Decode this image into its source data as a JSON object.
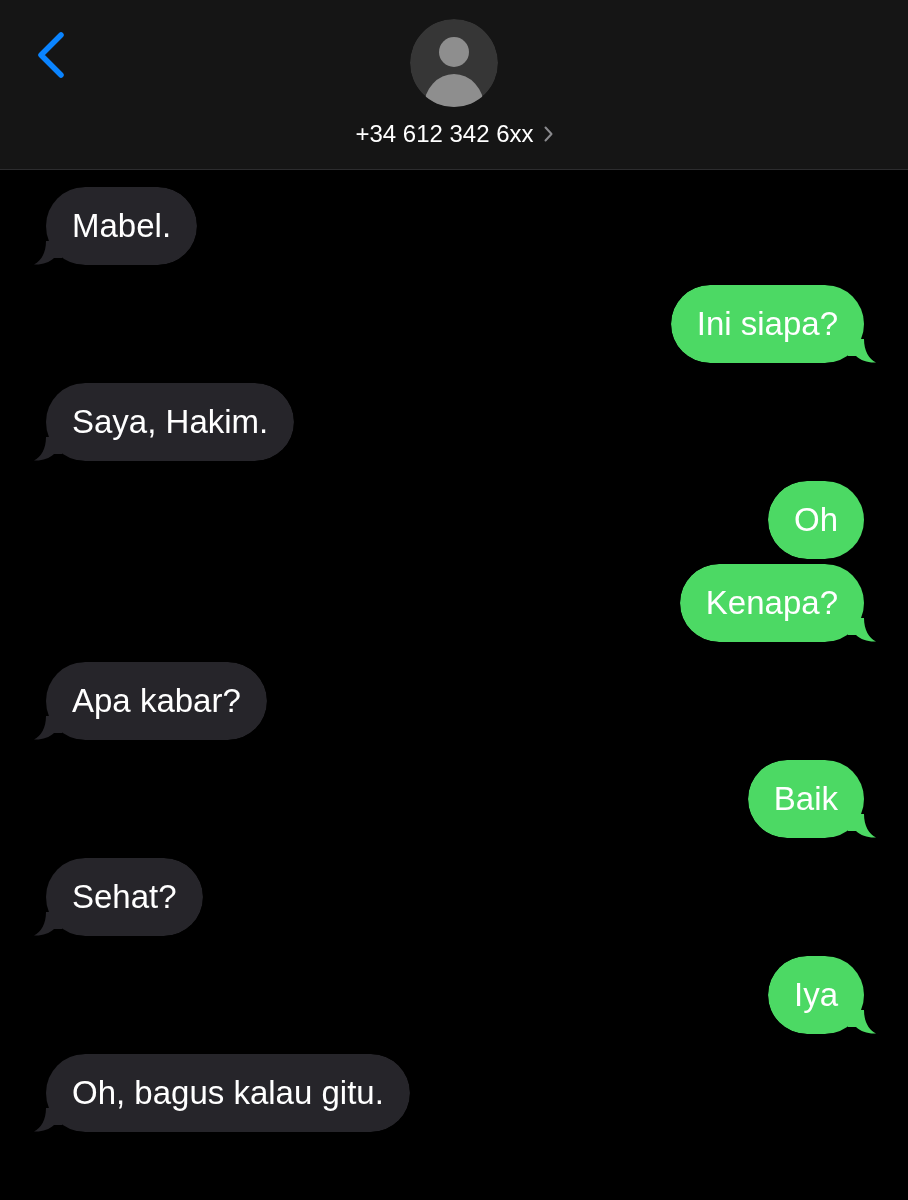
{
  "header": {
    "contact": "+34 612 342 6xx"
  },
  "messages": [
    {
      "kind": "received",
      "text": "Mabel.",
      "tail": true
    },
    {
      "kind": "sent",
      "text": "Ini siapa?",
      "tail": true
    },
    {
      "kind": "received",
      "text": "Saya, Hakim.",
      "tail": true
    },
    {
      "kind": "sent",
      "text": "Oh",
      "tail": false
    },
    {
      "kind": "sent",
      "text": "Kenapa?",
      "tail": true
    },
    {
      "kind": "received",
      "text": "Apa kabar?",
      "tail": true
    },
    {
      "kind": "sent",
      "text": "Baik",
      "tail": true
    },
    {
      "kind": "received",
      "text": "Sehat?",
      "tail": true
    },
    {
      "kind": "sent",
      "text": "Iya",
      "tail": true
    },
    {
      "kind": "received",
      "text": "Oh, bagus kalau gitu.",
      "tail": true
    }
  ]
}
